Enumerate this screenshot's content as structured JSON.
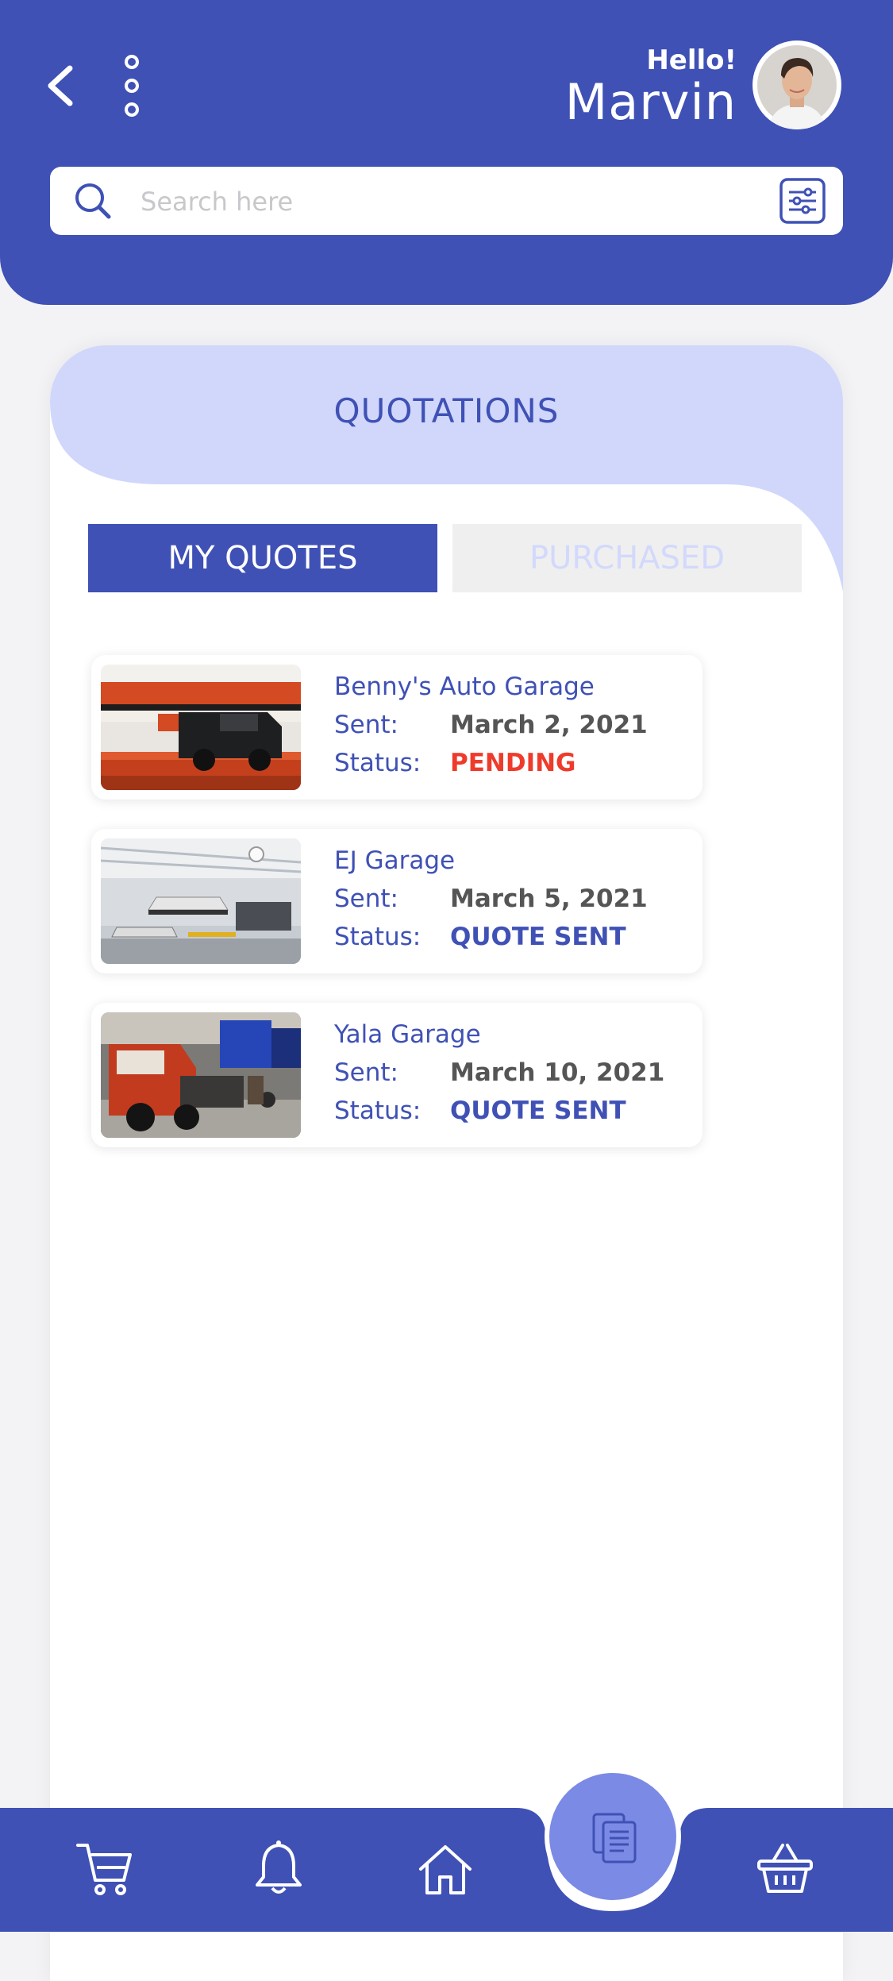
{
  "header": {
    "greeting": "Hello!",
    "user_name": "Marvin"
  },
  "search": {
    "placeholder": "Search here"
  },
  "page": {
    "title": "QUOTATIONS"
  },
  "tabs": [
    {
      "label": "MY QUOTES",
      "active": true
    },
    {
      "label": "PURCHASED",
      "active": false
    }
  ],
  "labels": {
    "sent": "Sent:",
    "status": "Status:"
  },
  "quotes": [
    {
      "garage": "Benny's Auto Garage",
      "sent": "March 2, 2021",
      "status": "PENDING",
      "status_color": "#ee3b2b"
    },
    {
      "garage": "EJ Garage",
      "sent": "March 5, 2021",
      "status": "QUOTE SENT",
      "status_color": "#3f51b5"
    },
    {
      "garage": "Yala Garage",
      "sent": "March 10, 2021",
      "status": "QUOTE SENT",
      "status_color": "#3f51b5"
    }
  ],
  "colors": {
    "primary": "#3f51b5",
    "header_tint": "#d0d7fb",
    "fab": "#7b8ae4"
  },
  "bottom_nav": [
    {
      "icon": "cart-icon"
    },
    {
      "icon": "bell-icon"
    },
    {
      "icon": "home-icon"
    },
    {
      "icon": "documents-icon",
      "active": true
    },
    {
      "icon": "basket-icon"
    }
  ]
}
